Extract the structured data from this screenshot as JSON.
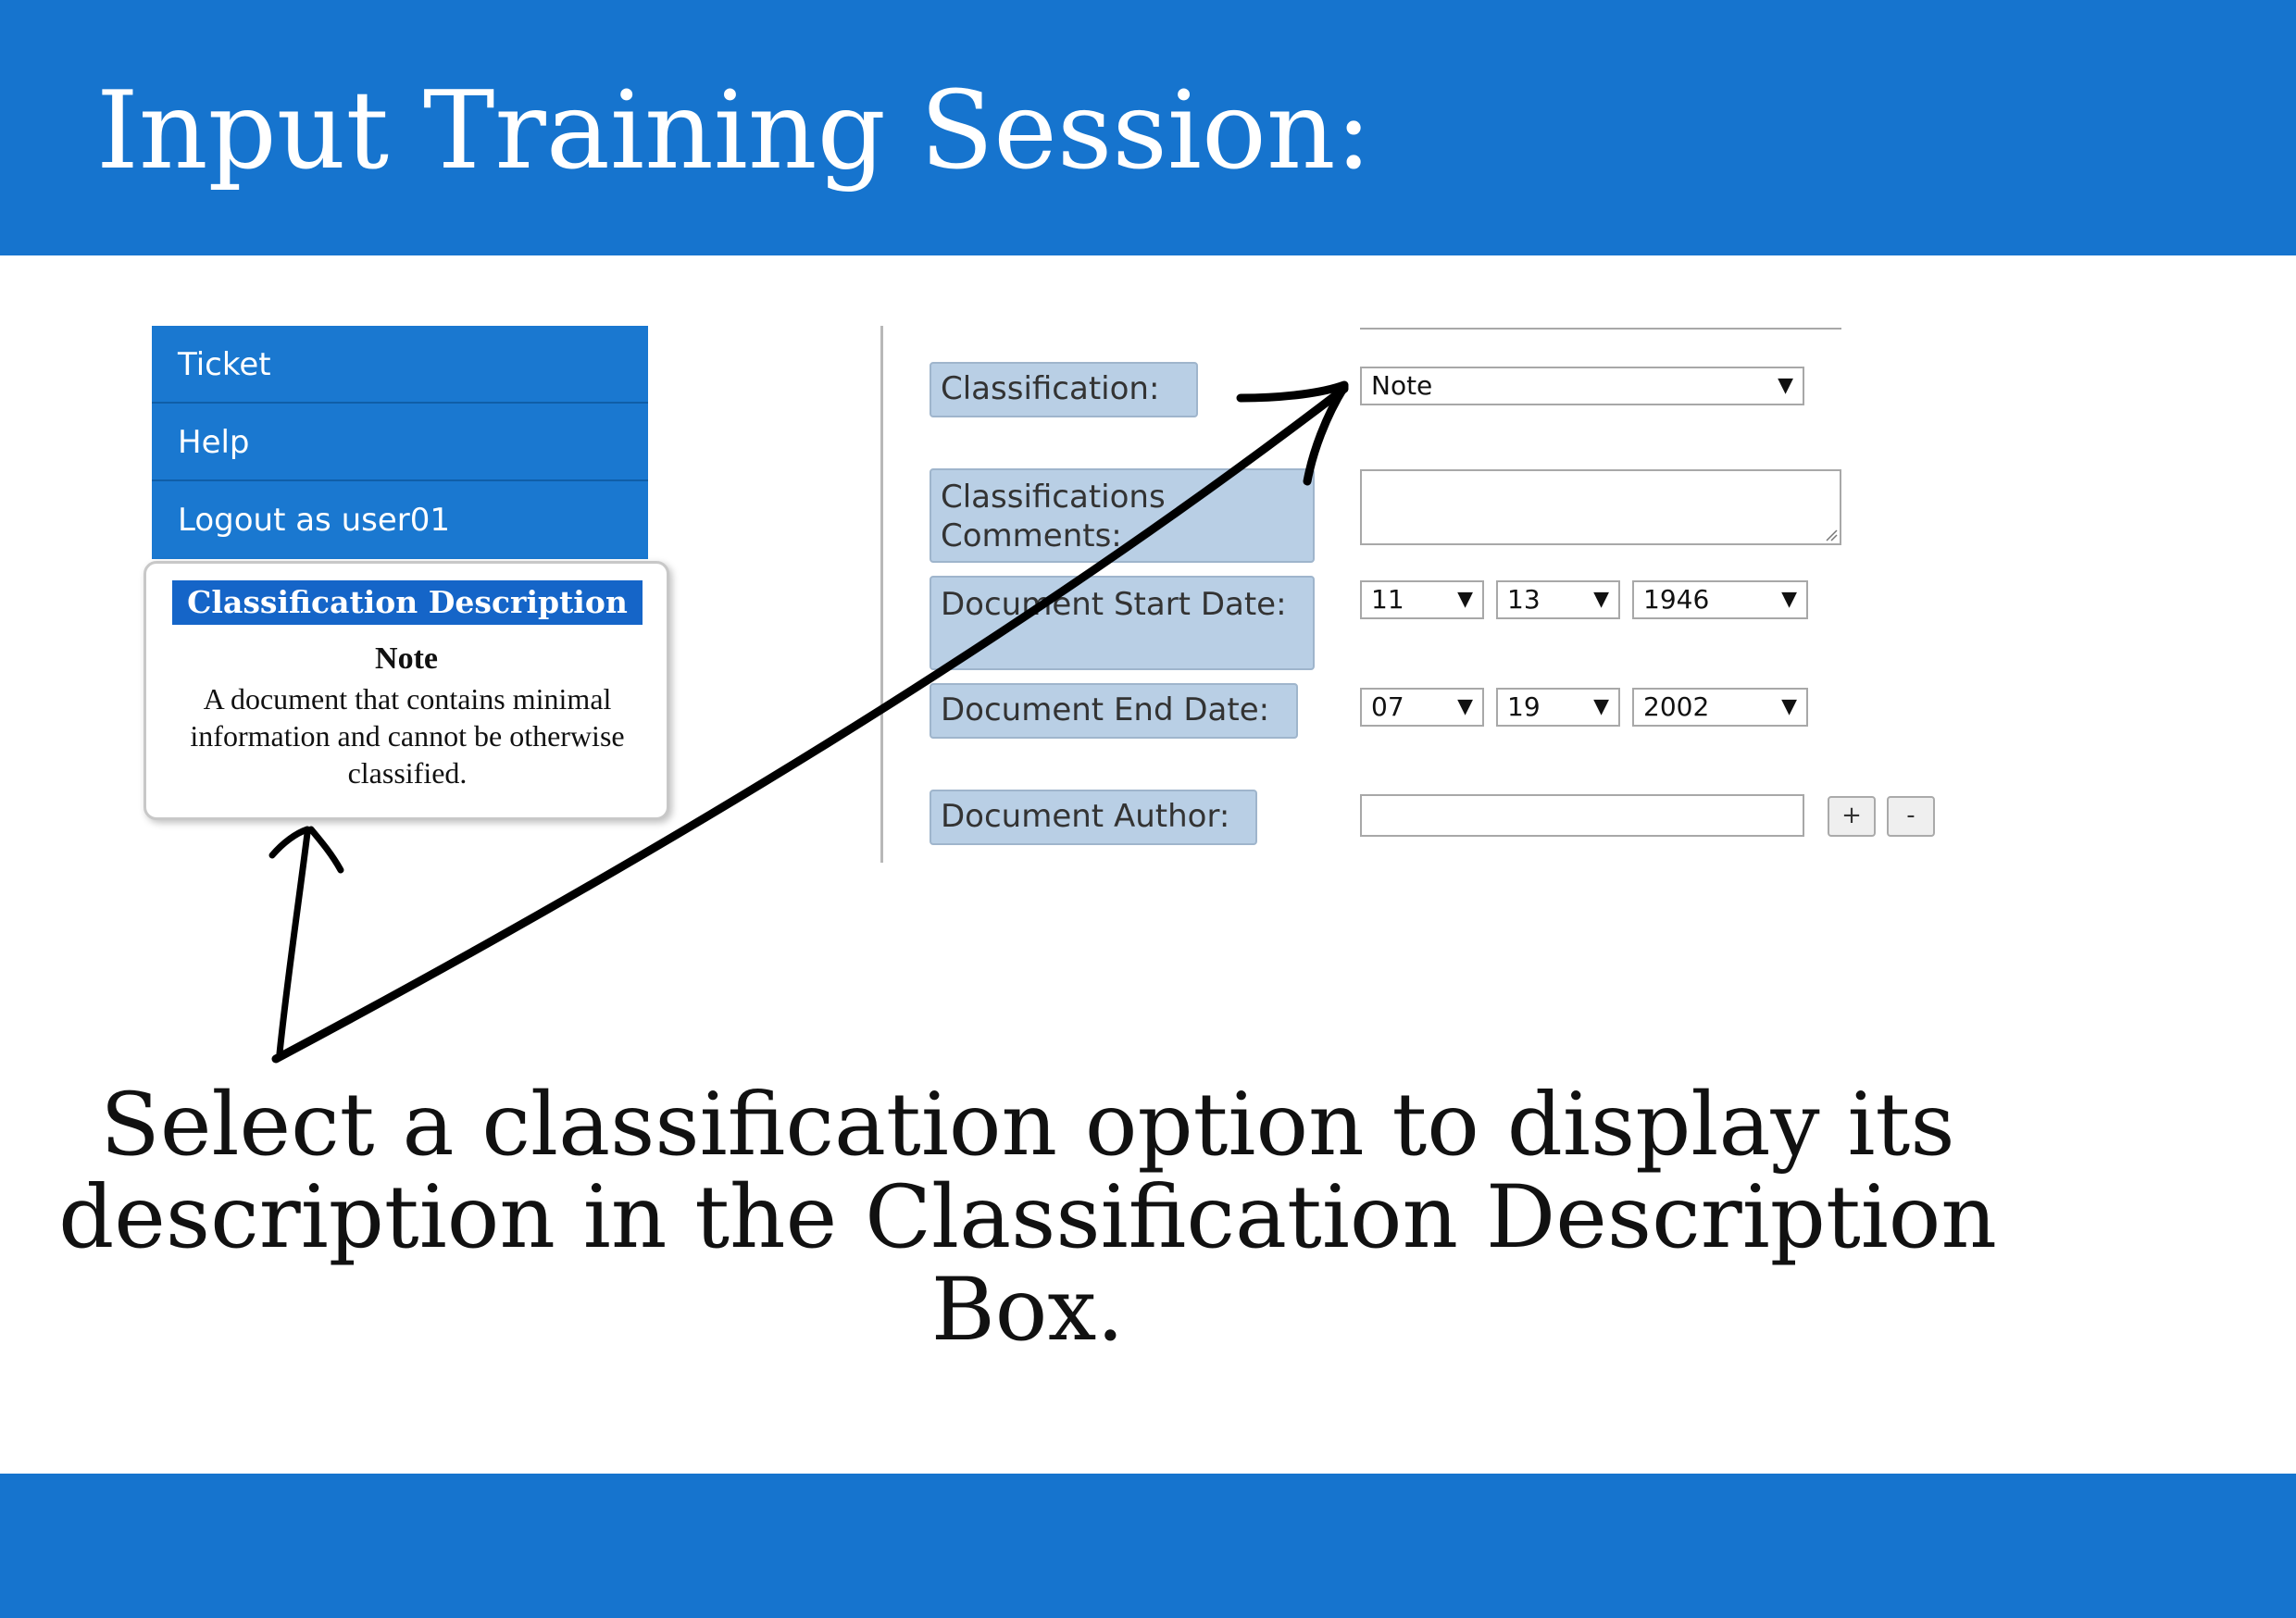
{
  "slide": {
    "title": "Input Training Session:",
    "instruction": "Select a classification option to display its description in the Classification Description Box."
  },
  "nav": {
    "items": [
      {
        "label": "Ticket"
      },
      {
        "label": "Help"
      },
      {
        "label": "Logout as user01"
      }
    ]
  },
  "description_box": {
    "header": "Classification Description",
    "name": "Note",
    "text": "A document that contains minimal information and cannot be otherwise classified."
  },
  "form": {
    "classification": {
      "label": "Classification:",
      "value": "Note"
    },
    "comments": {
      "label": "Classifications Comments:",
      "value": ""
    },
    "start_date": {
      "label": "Document Start Date:",
      "month": "11",
      "day": "13",
      "year": "1946"
    },
    "end_date": {
      "label": "Document End Date:",
      "month": "07",
      "day": "19",
      "year": "2002"
    },
    "author": {
      "label": "Document Author:",
      "value": "",
      "add_label": "+",
      "remove_label": "-"
    }
  },
  "colors": {
    "banner": "#1674ce",
    "nav": "#1a78d0",
    "label_bg": "#b9cfe5",
    "desc_header": "#1565c8"
  }
}
